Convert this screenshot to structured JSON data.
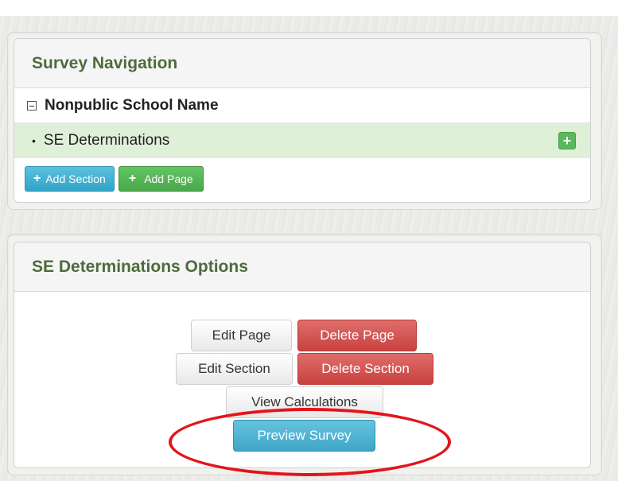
{
  "navigation": {
    "title": "Survey Navigation",
    "root_label": "Nonpublic School Name",
    "child_bullet": "•",
    "child_label": "SE Determinations",
    "add_icon": "+",
    "add_section_label": "Add Section",
    "add_page_label": "Add Page"
  },
  "options": {
    "title": "SE Determinations Options",
    "edit_page_label": "Edit Page",
    "delete_page_label": "Delete Page",
    "edit_section_label": "Edit Section",
    "delete_section_label": "Delete Section",
    "view_calculations_label": "View Calculations",
    "preview_survey_label": "Preview Survey"
  },
  "colors": {
    "heading_green": "#4d6b3d",
    "highlight_row": "#dff0d8",
    "danger": "#d9534f",
    "info": "#5bc0de",
    "success": "#5cb85c",
    "annotation": "#e3151a"
  },
  "icons": {
    "collapse": "minus-square-icon",
    "add": "plus-icon"
  }
}
